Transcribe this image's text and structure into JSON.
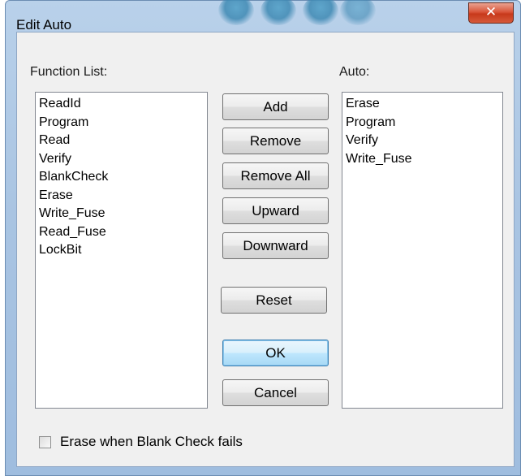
{
  "window": {
    "title": "Edit Auto",
    "close_glyph": "✕"
  },
  "function_list": {
    "label": "Function List:",
    "items": [
      "ReadId",
      "Program",
      "Read",
      "Verify",
      "BlankCheck",
      "Erase",
      "Write_Fuse",
      "Read_Fuse",
      "LockBit"
    ]
  },
  "auto_list": {
    "label": "Auto:",
    "items": [
      "Erase",
      "Program",
      "Verify",
      "Write_Fuse"
    ]
  },
  "buttons": {
    "add": "Add",
    "remove": "Remove",
    "remove_all": "Remove All",
    "upward": "Upward",
    "downward": "Downward",
    "reset": "Reset",
    "ok": "OK",
    "cancel": "Cancel"
  },
  "options": {
    "erase_on_blank_fail_label": "Erase when Blank Check fails",
    "erase_on_blank_fail_checked": false
  },
  "colors": {
    "title_bar": "#b9d1ea",
    "close_button": "#c7391b",
    "dialog_face": "#f0f0f0"
  }
}
